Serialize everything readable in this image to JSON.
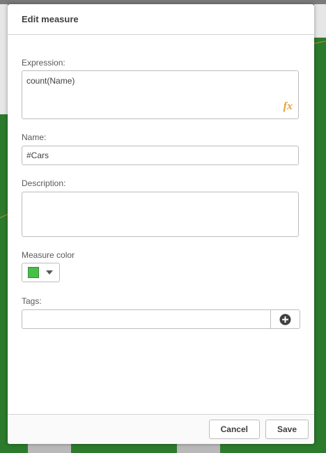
{
  "dialog": {
    "title": "Edit measure",
    "expression": {
      "label": "Expression:",
      "value": "count(Name)",
      "fx_symbol": "fx"
    },
    "name": {
      "label": "Name:",
      "value": "#Cars"
    },
    "description": {
      "label": "Description:",
      "value": ""
    },
    "measure_color": {
      "label": "Measure color",
      "color": "#46c046"
    },
    "tags": {
      "label": "Tags:",
      "value": ""
    },
    "footer": {
      "cancel_label": "Cancel",
      "save_label": "Save"
    }
  }
}
